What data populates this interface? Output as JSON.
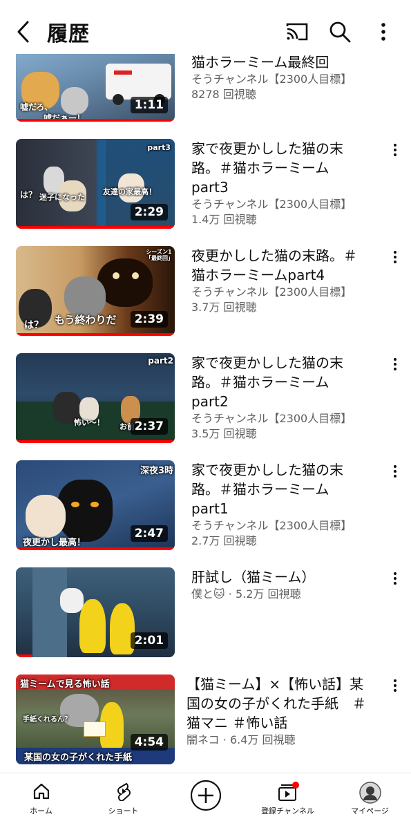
{
  "header": {
    "title": "履歴",
    "icons": [
      "back-arrow-icon",
      "cast-icon",
      "search-icon",
      "more-vert-icon"
    ]
  },
  "videos": [
    {
      "title": "猫ホラーミーム最終回",
      "channel": "そうチャンネル【2300人目標】",
      "views": "8278 回視聴",
      "duration": "1:11",
      "thumb_text": [
        "嘘だろ、",
        "嘘だぁー！"
      ],
      "progress": 1.0
    },
    {
      "title": "家で夜更かしした猫の末路。＃猫ホラーミーム\npart3",
      "channel": "そうチャンネル【2300人目標】",
      "views": "1.4万 回視聴",
      "duration": "2:29",
      "thumb_text": [
        "part3",
        "は？",
        "迷子になった",
        "友達の家最高！"
      ],
      "progress": 1.0
    },
    {
      "title": "夜更かしした猫の末路。＃猫ホラーミームpart4",
      "channel": "そうチャンネル【2300人目標】",
      "views": "3.7万 回視聴",
      "duration": "2:39",
      "thumb_text": [
        "シーズン1「最終回」",
        "は？",
        "もう終わりだ"
      ],
      "progress": 1.0
    },
    {
      "title": "家で夜更かしした猫の末路。＃猫ホラーミーム\npart2",
      "channel": "そうチャンネル【2300人目標】",
      "views": "3.5万 回視聴",
      "duration": "2:37",
      "thumb_text": [
        "part2",
        "怖い〜！",
        "お前"
      ],
      "progress": 1.0
    },
    {
      "title": "家で夜更かしした猫の末路。＃猫ホラーミーム\npart1",
      "channel": "そうチャンネル【2300人目標】",
      "views": "2.7万 回視聴",
      "duration": "2:47",
      "thumb_text": [
        "深夜3時",
        "夜更かし最高！"
      ],
      "progress": 1.0
    },
    {
      "title": "肝試し（猫ミーム）",
      "channel": "僕と🐱",
      "views": "5.2万 回視聴",
      "channel_views": "僕と🐱 · 5.2万 回視聴",
      "duration": "2:01",
      "thumb_text": [],
      "progress": 0.1
    },
    {
      "title": "【猫ミーム】×【怖い話】某国の女の子がくれた手紙　＃猫マニ ＃怖い話",
      "channel": "闇ネコ",
      "views": "6.4万 回視聴",
      "channel_views": "闇ネコ · 6.4万 回視聴",
      "duration": "4:54",
      "thumb_text": [
        "猫ミームで見る怖い話",
        "手紙くれるん？",
        "某国の女の子がくれた手紙"
      ],
      "progress": 0.0
    }
  ],
  "bottom_nav": [
    {
      "label": "ホーム",
      "icon": "home-icon"
    },
    {
      "label": "ショート",
      "icon": "shorts-icon"
    },
    {
      "label": "",
      "icon": "create-plus-icon"
    },
    {
      "label": "登録チャンネル",
      "icon": "subscriptions-icon"
    },
    {
      "label": "マイページ",
      "icon": "avatar"
    }
  ],
  "colors": {
    "accent": "#ff0000",
    "text": "#0f0f0f",
    "secondary": "#606060"
  }
}
